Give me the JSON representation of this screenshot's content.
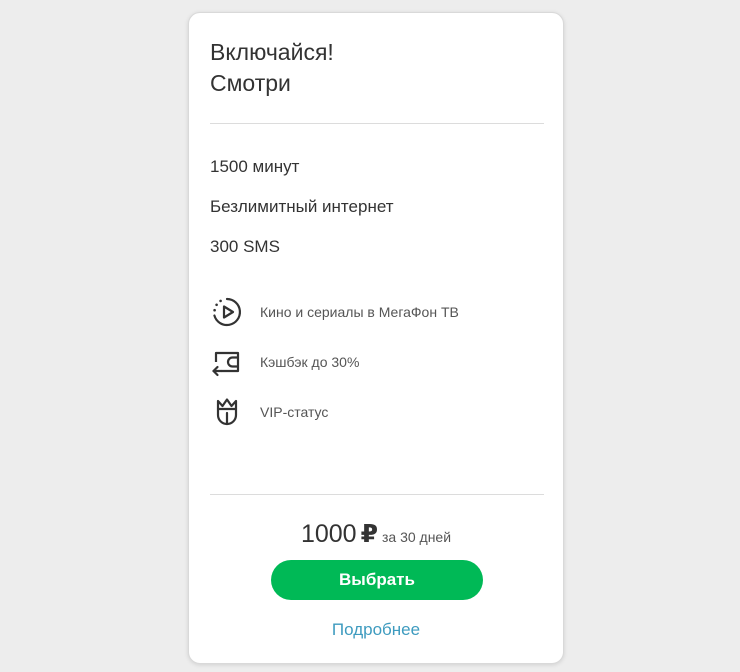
{
  "tariff": {
    "title_line1": "Включайся!",
    "title_line2": "Смотри"
  },
  "features": [
    "1500 минут",
    "Безлимитный интернет",
    "300 SMS"
  ],
  "services": [
    {
      "icon": "play-circle-icon",
      "label": "Кино и сериалы в МегаФон ТВ"
    },
    {
      "icon": "cashback-wallet-icon",
      "label": "Кэшбэк до 30%"
    },
    {
      "icon": "crown-status-icon",
      "label": "VIP-статус"
    }
  ],
  "price": {
    "amount": "1000",
    "currency": "₽",
    "period": "за 30 дней"
  },
  "actions": {
    "select_label": "Выбрать",
    "more_label": "Подробнее"
  },
  "colors": {
    "accent_green": "#00b956",
    "link_blue": "#3e9bbf",
    "background": "#ededed"
  }
}
